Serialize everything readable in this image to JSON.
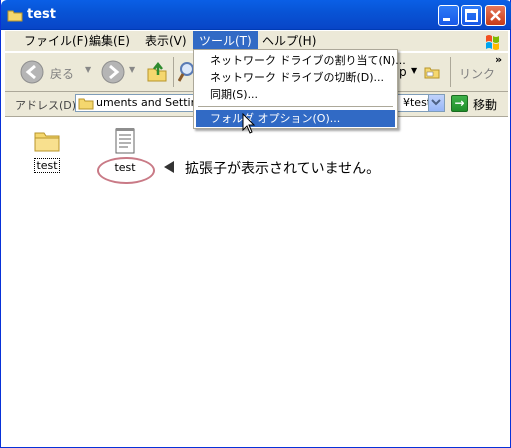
{
  "window": {
    "title": "test"
  },
  "menubar": {
    "items": [
      "ファイル(F)",
      "編集(E)",
      "表示(V)",
      "ツール(T)",
      "ヘルプ(H)"
    ],
    "active_index": 3
  },
  "toolbar": {
    "back_label": "戻る",
    "partial_label": "p",
    "links_label": "リンク"
  },
  "address": {
    "label": "アドレス(D)",
    "value": "uments and Settine",
    "value_tail": "¥test",
    "go_label": "移動"
  },
  "files": [
    {
      "name": "test",
      "type": "folder",
      "icon": "folder-icon"
    },
    {
      "name": "test",
      "type": "file",
      "icon": "text-file-icon"
    }
  ],
  "annotation": {
    "text": "拡張子が表示されていません。"
  },
  "tools_menu": {
    "items": [
      "ネットワーク ドライブの割り当て(N)...",
      "ネットワーク ドライブの切断(D)...",
      "同期(S)...",
      "フォルダ オプション(O)..."
    ],
    "highlighted_index": 3
  },
  "colors": {
    "titlebar": "#0A5FE6",
    "menu_highlight": "#316AC5",
    "chrome": "#ECE9D8",
    "annotation_circle": "#C97A86"
  }
}
